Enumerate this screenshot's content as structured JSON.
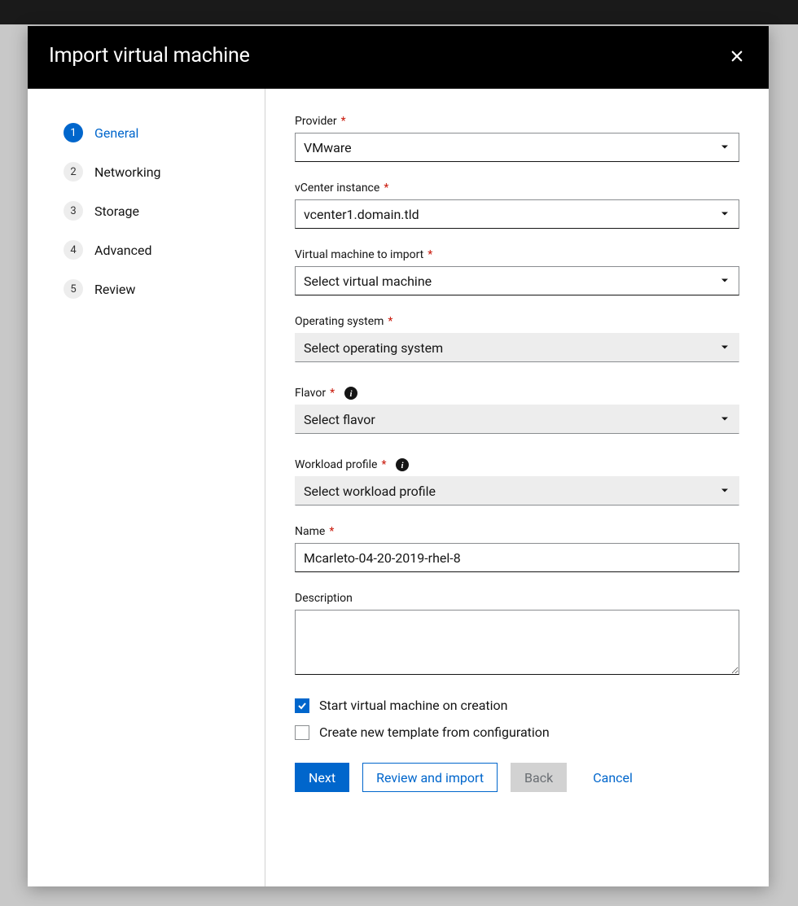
{
  "header": {
    "title": "Import virtual machine"
  },
  "steps": [
    {
      "num": "1",
      "label": "General",
      "active": true
    },
    {
      "num": "2",
      "label": "Networking",
      "active": false
    },
    {
      "num": "3",
      "label": "Storage",
      "active": false
    },
    {
      "num": "4",
      "label": "Advanced",
      "active": false
    },
    {
      "num": "5",
      "label": "Review",
      "active": false
    }
  ],
  "form": {
    "provider": {
      "label": "Provider",
      "value": "VMware",
      "required": true
    },
    "vcenter": {
      "label": "vCenter instance",
      "value": "vcenter1.domain.tld",
      "required": true
    },
    "vm": {
      "label": "Virtual machine to import",
      "value": "Select virtual machine",
      "required": true
    },
    "os": {
      "label": "Operating system",
      "value": "Select operating system",
      "required": true,
      "disabled": true
    },
    "flavor": {
      "label": "Flavor",
      "value": "Select flavor",
      "required": true,
      "info": true,
      "disabled": true
    },
    "workload": {
      "label": "Workload profile",
      "value": "Select workload profile",
      "required": true,
      "info": true,
      "disabled": true
    },
    "name": {
      "label": "Name",
      "value": "Mcarleto-04-20-2019-rhel-8",
      "required": true
    },
    "description": {
      "label": "Description",
      "value": ""
    },
    "start_vm": {
      "label": "Start virtual machine on creation",
      "checked": true
    },
    "create_template": {
      "label": "Create new template from configuration",
      "checked": false
    }
  },
  "footer": {
    "next": "Next",
    "review": "Review and import",
    "back": "Back",
    "cancel": "Cancel"
  }
}
